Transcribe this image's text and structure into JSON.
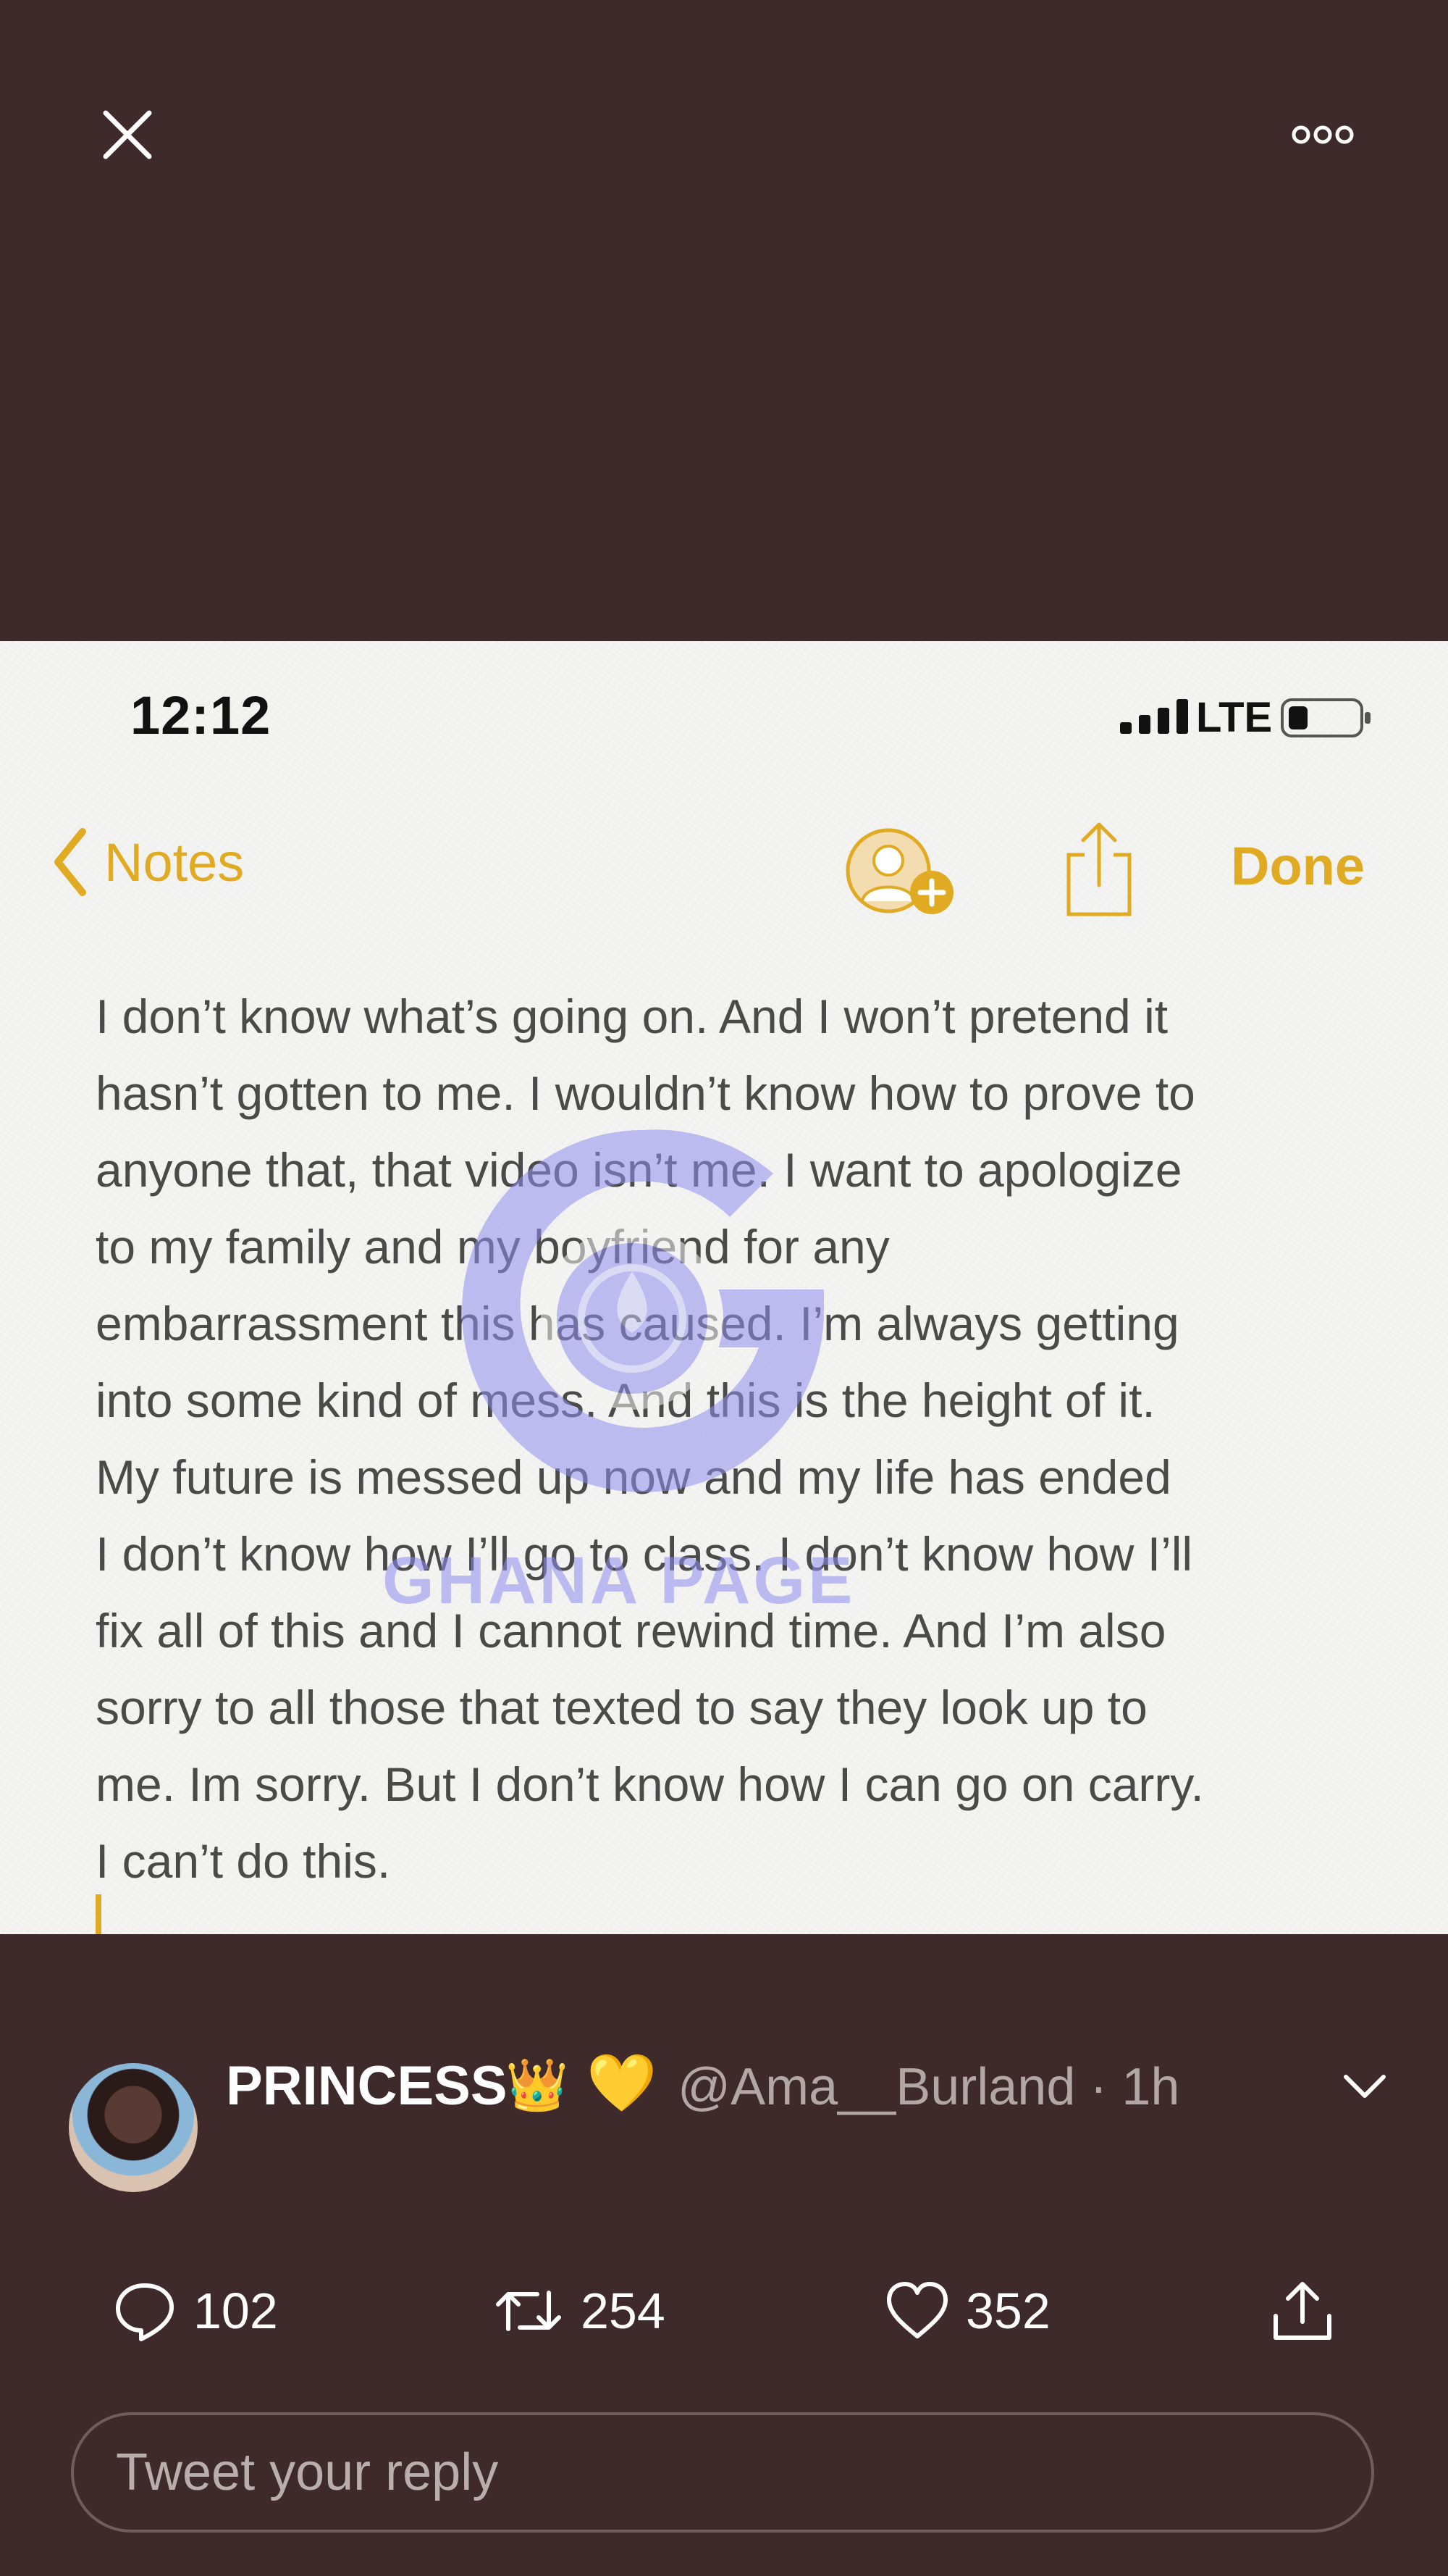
{
  "viewer": {
    "close_icon": "close-icon",
    "more_icon": "more-options-icon"
  },
  "note_screen": {
    "status_bar": {
      "time": "12:12",
      "carrier": "LTE"
    },
    "nav": {
      "back_label": "Notes",
      "done_label": "Done"
    },
    "note_text": "I don’t know what’s going on. And I won’t pretend it\nhasn’t gotten to me. I wouldn’t know how to prove to\nanyone that, that video isn’t me. I want to apologize\nto my family and my boyfriend for any\nembarrassment this has caused. I’m always getting\ninto some kind of mess. And this is the height of it.\nMy future is messed up now and my life has ended\nI don’t know how I’ll go to class. I don’t know how I’ll\nfix all of this and I cannot rewind time. And I’m also\nsorry to all those that texted to say they look up to\nme. Im sorry. But I don’t know how I can go on carry.\nI can’t do this.",
    "watermark_text": "GHANA PAGE",
    "accent_color": "#e0aa22"
  },
  "tweet": {
    "display_name": "PRINCESS",
    "crown_emoji": "👑",
    "heart_emoji": "💛",
    "handle_time": "@Ama__Burland · 1h",
    "reply_count": "102",
    "retweet_count": "254",
    "like_count": "352",
    "reply_placeholder": "Tweet your reply"
  }
}
